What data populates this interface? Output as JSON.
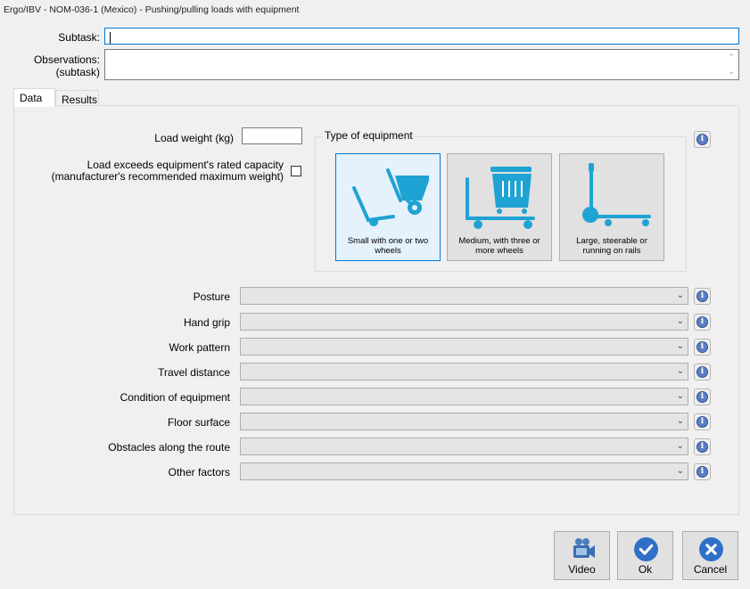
{
  "window": {
    "title": "Ergo/IBV - NOM-036-1 (Mexico) - Pushing/pulling loads with equipment"
  },
  "subtask": {
    "label": "Subtask:",
    "value": ""
  },
  "observations": {
    "label_line1": "Observations:",
    "label_line2": "(subtask)",
    "value": ""
  },
  "tabs": [
    {
      "label": "Data",
      "active": true
    },
    {
      "label": "Results",
      "active": false
    }
  ],
  "load_weight": {
    "label": "Load weight (kg)",
    "value": ""
  },
  "capacity": {
    "label_line1": "Load exceeds equipment's rated capacity",
    "label_line2": "(manufacturer's recommended maximum weight)",
    "checked": false
  },
  "equipment": {
    "group_title": "Type of equipment",
    "options": [
      {
        "line1": "Small with one or two",
        "line2": "wheels",
        "icon": "wheelbarrow-icon",
        "selected": true
      },
      {
        "line1": "Medium, with three or",
        "line2": "more wheels",
        "icon": "cart-icon",
        "selected": false
      },
      {
        "line1": "Large, steerable or",
        "line2": "running on rails",
        "icon": "pallet-jack-icon",
        "selected": false
      }
    ]
  },
  "factors": [
    {
      "label": "Posture",
      "value": ""
    },
    {
      "label": "Hand grip",
      "value": ""
    },
    {
      "label": "Work pattern",
      "value": ""
    },
    {
      "label": "Travel distance",
      "value": ""
    },
    {
      "label": "Condition of equipment",
      "value": ""
    },
    {
      "label": "Floor surface",
      "value": ""
    },
    {
      "label": "Obstacles along the route",
      "value": ""
    },
    {
      "label": "Other factors",
      "value": ""
    }
  ],
  "buttons": {
    "video": "Video",
    "ok": "Ok",
    "cancel": "Cancel"
  },
  "colors": {
    "accent": "#0078d7",
    "icon_teal": "#1fa3d4",
    "ok_blue": "#2f6fc7",
    "cancel_blue": "#2f6fc7"
  }
}
